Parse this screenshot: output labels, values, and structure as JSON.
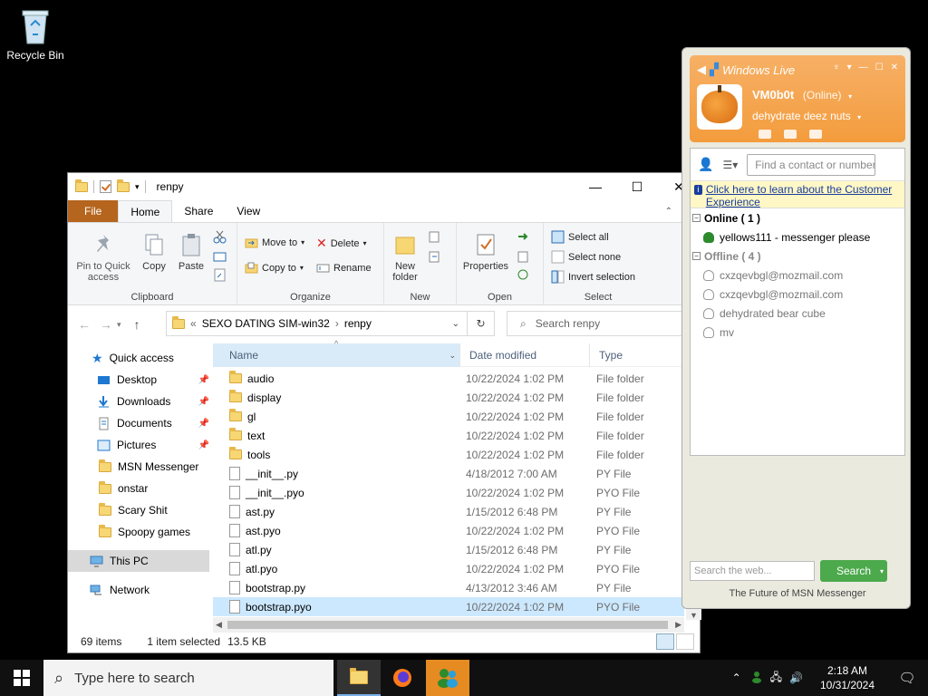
{
  "desktop": {
    "recycle_bin": "Recycle Bin"
  },
  "explorer": {
    "title": "renpy",
    "tabs": [
      "File",
      "Home",
      "Share",
      "View"
    ],
    "clipboard": {
      "pin": "Pin to Quick access",
      "copy": "Copy",
      "paste": "Paste",
      "label": "Clipboard"
    },
    "organize": {
      "move_to": "Move to",
      "delete": "Delete",
      "copy_to": "Copy to",
      "rename": "Rename",
      "label": "Organize"
    },
    "new": {
      "new_folder": "New folder",
      "label": "New"
    },
    "open": {
      "properties": "Properties",
      "label": "Open"
    },
    "select": {
      "select_all": "Select all",
      "select_none": "Select none",
      "invert": "Invert selection",
      "label": "Select"
    },
    "address": {
      "parent": "SEXO DATING SIM-win32",
      "current": "renpy"
    },
    "search_placeholder": "Search renpy",
    "columns": {
      "name": "Name",
      "date": "Date modified",
      "type": "Type"
    },
    "nav": {
      "quick_access": "Quick access",
      "items": [
        "Desktop",
        "Downloads",
        "Documents",
        "Pictures",
        "MSN Messenger",
        "onstar",
        "Scary Shit",
        "Spoopy games"
      ],
      "this_pc": "This PC",
      "network": "Network"
    },
    "files": [
      {
        "name": "audio",
        "date": "10/22/2024 1:02 PM",
        "type": "File folder"
      },
      {
        "name": "display",
        "date": "10/22/2024 1:02 PM",
        "type": "File folder"
      },
      {
        "name": "gl",
        "date": "10/22/2024 1:02 PM",
        "type": "File folder"
      },
      {
        "name": "text",
        "date": "10/22/2024 1:02 PM",
        "type": "File folder"
      },
      {
        "name": "tools",
        "date": "10/22/2024 1:02 PM",
        "type": "File folder"
      },
      {
        "name": "__init__.py",
        "date": "4/18/2012 7:00 AM",
        "type": "PY File"
      },
      {
        "name": "__init__.pyo",
        "date": "10/22/2024 1:02 PM",
        "type": "PYO File"
      },
      {
        "name": "ast.py",
        "date": "1/15/2012 6:48 PM",
        "type": "PY File"
      },
      {
        "name": "ast.pyo",
        "date": "10/22/2024 1:02 PM",
        "type": "PYO File"
      },
      {
        "name": "atl.py",
        "date": "1/15/2012 6:48 PM",
        "type": "PY File"
      },
      {
        "name": "atl.pyo",
        "date": "10/22/2024 1:02 PM",
        "type": "PYO File"
      },
      {
        "name": "bootstrap.py",
        "date": "4/13/2012 3:46 AM",
        "type": "PY File"
      },
      {
        "name": "bootstrap.pyo",
        "date": "10/22/2024 1:02 PM",
        "type": "PYO File"
      }
    ],
    "status": {
      "count": "69 items",
      "selected": "1 item selected",
      "size": "13.5 KB"
    }
  },
  "msn": {
    "brand": "Windows Live",
    "username": "VM0b0t",
    "status": "(Online)",
    "psm": "dehydrate deez nuts",
    "find_placeholder": "Find a contact or number",
    "banner": "Click here to learn about the Customer Experience",
    "online_group": "Online ( 1 )",
    "online_contacts": [
      "yellows111 - messenger please"
    ],
    "offline_group": "Offline ( 4 )",
    "offline_contacts": [
      "cxzqevbgl@mozmail.com",
      "cxzqevbgl@mozmail.com",
      "dehydrated bear cube",
      "mv"
    ],
    "web_search_placeholder": "Search the web...",
    "search_button": "Search",
    "footer": "The Future of MSN Messenger"
  },
  "taskbar": {
    "search_placeholder": "Type here to search",
    "time": "2:18 AM",
    "date": "10/31/2024"
  }
}
